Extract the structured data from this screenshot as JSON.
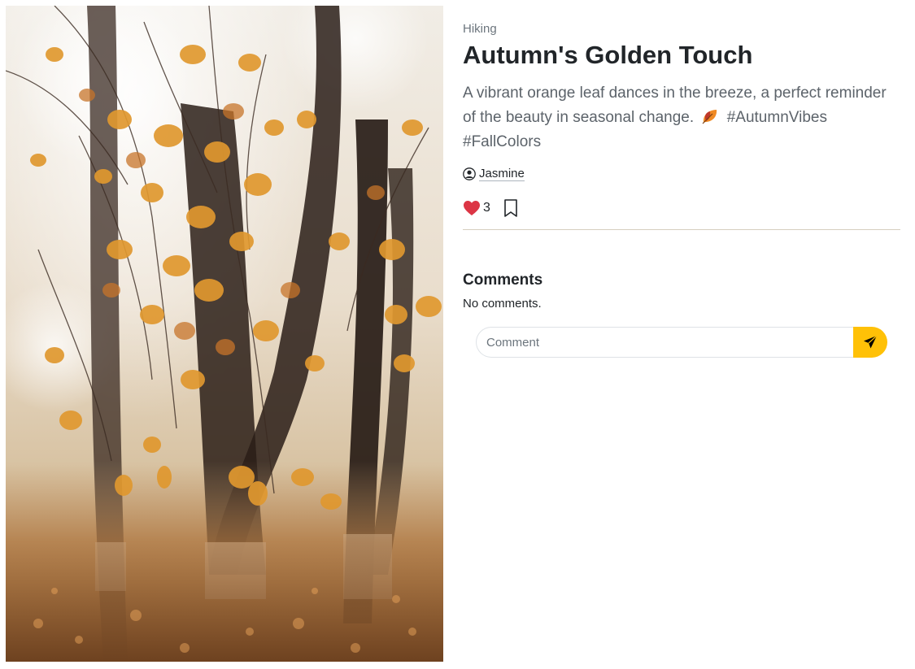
{
  "post": {
    "image_alt": "Autumn tree with orange leaves",
    "category": "Hiking",
    "title": "Autumn's Golden Touch",
    "description_before_emoji": "A vibrant orange leaf dances in the breeze, a perfect reminder of the beauty in seasonal change.",
    "emoji_icon": "fallen-leaf-icon",
    "description_after_emoji": "#AutumnVibes #FallColors",
    "author": "Jasmine",
    "likes": "3"
  },
  "comments": {
    "heading": "Comments",
    "empty_text": "No comments.",
    "input_placeholder": "Comment",
    "input_value": ""
  },
  "colors": {
    "heart": "#dc3545",
    "send_button": "#ffc107",
    "divider": "#d6cfbf"
  }
}
